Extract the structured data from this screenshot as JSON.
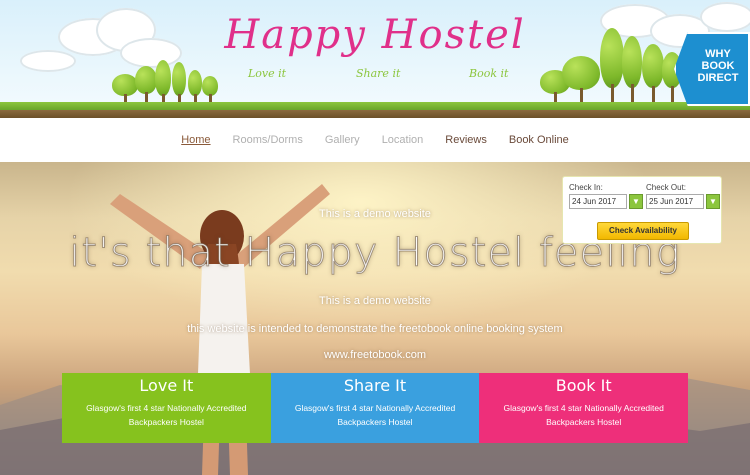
{
  "header": {
    "title": "Happy Hostel",
    "taglines": [
      "Love it",
      "Share it",
      "Book it"
    ],
    "badge": [
      "WHY",
      "BOOK",
      "DIRECT"
    ]
  },
  "nav": {
    "items": [
      "Home",
      "Rooms/Dorms",
      "Gallery",
      "Location",
      "Reviews",
      "Book Online"
    ],
    "active": "Home"
  },
  "hero": {
    "demo_top": "This is a demo website",
    "headline": "it's that Happy Hostel feeling",
    "demo_bottom": "This is a demo website",
    "intro": "this website is intended to demonstrate the freetobook online booking system",
    "link": "www.freetobook.com"
  },
  "booking": {
    "checkin_label": "Check In:",
    "checkin_value": "24 Jun 2017",
    "checkout_label": "Check Out:",
    "checkout_value": "25 Jun 2017",
    "button": "Check Availability"
  },
  "cards": [
    {
      "title": "Love It",
      "text": "Glasgow's first 4 star Nationally Accredited Backpackers Hostel",
      "color": "#86c21e"
    },
    {
      "title": "Share It",
      "text": "Glasgow's first 4 star Nationally Accredited Backpackers Hostel",
      "color": "#3aa0df"
    },
    {
      "title": "Book It",
      "text": "Glasgow's first 4 star Nationally Accredited Backpackers Hostel",
      "color": "#ee2f7a"
    }
  ],
  "colors": {
    "title": "#e0308a",
    "tagline": "#8cc63e",
    "badge": "#1d8fd0"
  }
}
